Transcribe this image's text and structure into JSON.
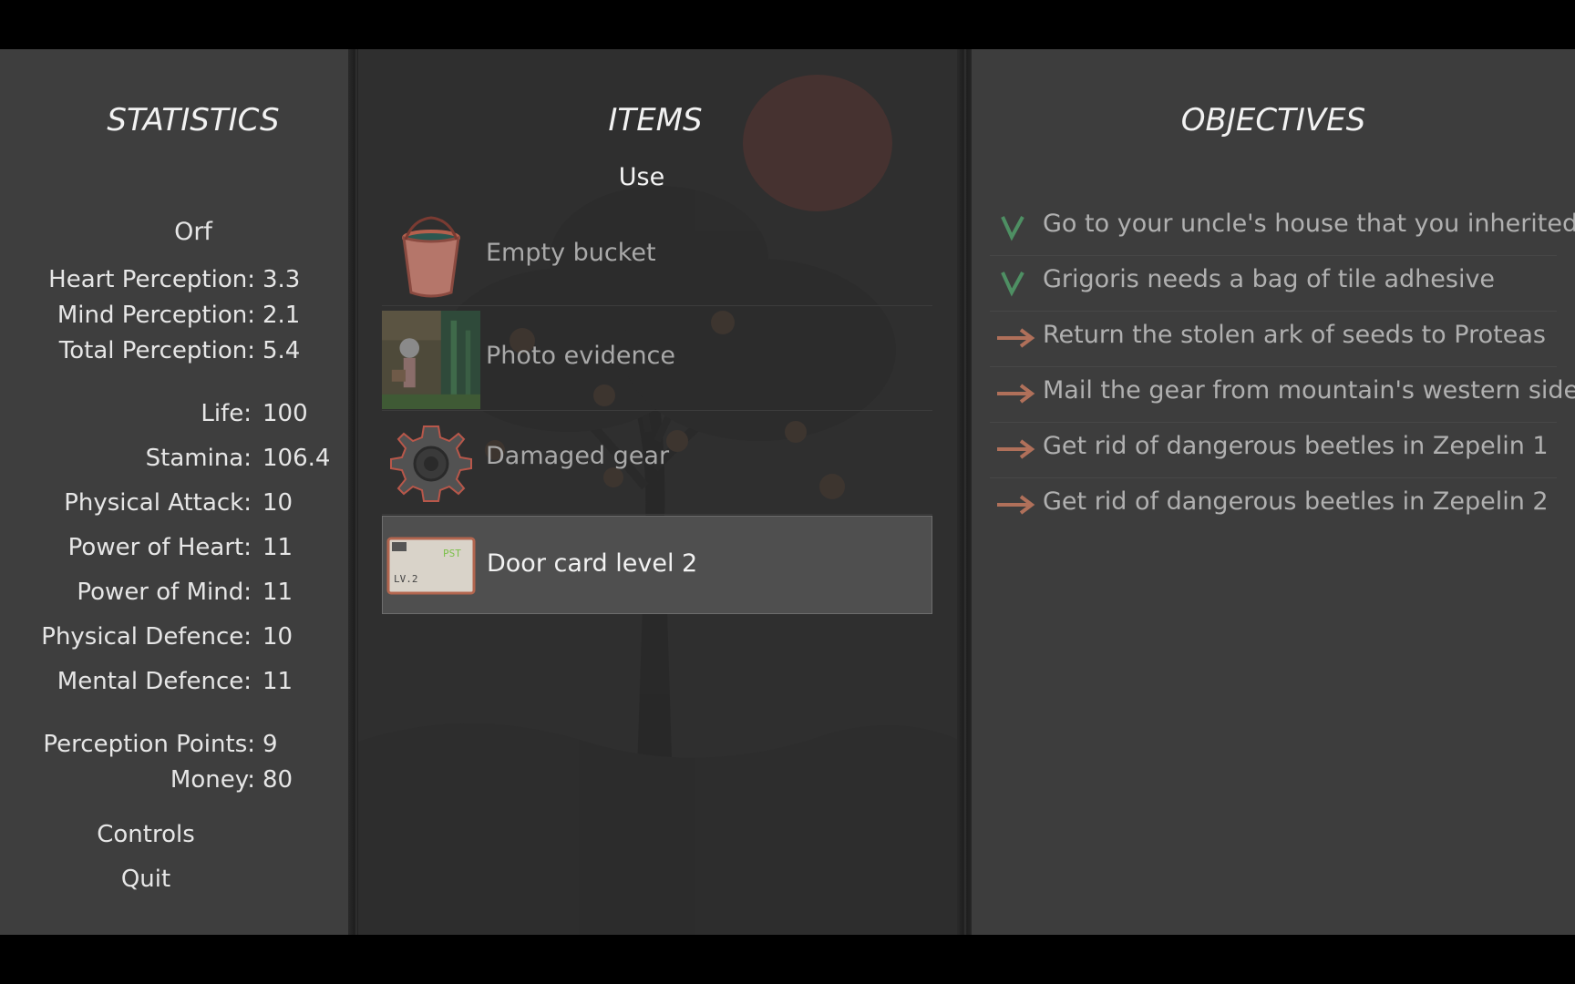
{
  "statistics": {
    "heading": "STATISTICS",
    "player_name": "Orf",
    "perception": [
      {
        "label": "Heart Perception:",
        "value": "3.3"
      },
      {
        "label": "Mind Perception:",
        "value": "2.1"
      },
      {
        "label": "Total Perception:",
        "value": "5.4"
      }
    ],
    "attributes": [
      {
        "label": "Life:",
        "value": "100"
      },
      {
        "label": "Stamina:",
        "value": "106.4"
      },
      {
        "label": "Physical Attack:",
        "value": "10"
      },
      {
        "label": "Power of Heart:",
        "value": "11"
      },
      {
        "label": "Power of Mind:",
        "value": "11"
      },
      {
        "label": "Physical Defence:",
        "value": "10"
      },
      {
        "label": "Mental Defence:",
        "value": "11"
      }
    ],
    "resources": [
      {
        "label": "Perception Points:",
        "value": "9"
      },
      {
        "label": "Money:",
        "value": "80"
      }
    ],
    "menu": {
      "controls": "Controls",
      "quit": "Quit"
    }
  },
  "items": {
    "heading": "ITEMS",
    "use_label": "Use",
    "list": [
      {
        "label": "Empty bucket",
        "icon": "bucket-icon",
        "selected": false
      },
      {
        "label": "Photo evidence",
        "icon": "photo-icon",
        "selected": false
      },
      {
        "label": "Damaged gear",
        "icon": "gear-icon",
        "selected": false
      },
      {
        "label": "Door card level 2",
        "icon": "keycard-icon",
        "selected": true
      }
    ],
    "keycard_text": {
      "top": "PST",
      "level": "LV.2"
    }
  },
  "objectives": {
    "heading": "OBJECTIVES",
    "list": [
      {
        "text": "Go to your uncle's house that you inherited",
        "status": "completed"
      },
      {
        "text": "Grigoris needs a bag of tile adhesive",
        "status": "completed"
      },
      {
        "text": "Return the stolen ark of seeds to Proteas",
        "status": "active"
      },
      {
        "text": "Mail the gear from mountain's western side",
        "status": "active"
      },
      {
        "text": "Get rid of dangerous beetles in Zepelin 1",
        "status": "active"
      },
      {
        "text": "Get rid of dangerous beetles in Zepelin 2",
        "status": "active"
      }
    ]
  },
  "colors": {
    "check": "#4e8f63",
    "arrow": "#b0705a",
    "selected_bg": "#4f4f4f"
  }
}
